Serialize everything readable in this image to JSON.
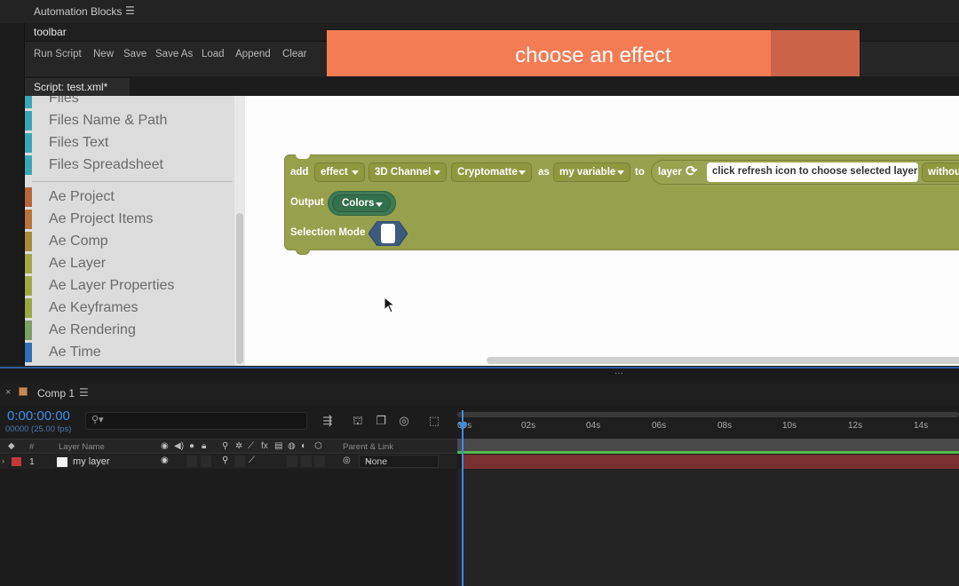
{
  "panel": {
    "title": "Automation Blocks",
    "menu_icon": "hamburger-icon"
  },
  "toolbar": {
    "label": "toolbar",
    "items": [
      "Run Script",
      "New",
      "Save",
      "Save As",
      "Load",
      "Append",
      "Clear"
    ]
  },
  "banner": {
    "text": "choose an effect",
    "color": "#f47c55"
  },
  "tab": {
    "label": "Script: test.xml*"
  },
  "categories": [
    {
      "label": "Files",
      "color": "#3ba7b5"
    },
    {
      "label": "Files Name & Path",
      "color": "#3ba7b5"
    },
    {
      "label": "Files Text",
      "color": "#3ba7b5"
    },
    {
      "label": "Files Spreadsheet",
      "color": "#3ba7b5"
    },
    {
      "label": "Ae Project",
      "color": "#b8663c"
    },
    {
      "label": "Ae Project Items",
      "color": "#b8733c"
    },
    {
      "label": "Ae Comp",
      "color": "#a88a3a"
    },
    {
      "label": "Ae Layer",
      "color": "#a3a744"
    },
    {
      "label": "Ae Layer Properties",
      "color": "#a0a844"
    },
    {
      "label": "Ae Keyframes",
      "color": "#9aa844"
    },
    {
      "label": "Ae Rendering",
      "color": "#78a063"
    },
    {
      "label": "Ae Time",
      "color": "#2f6fb5"
    }
  ],
  "block": {
    "add": "add",
    "effect": "effect",
    "channel": "3D Channel",
    "effect_name": "Cryptomatte",
    "as": "as",
    "variable": "my variable",
    "to": "to",
    "layer": "layer",
    "refresh_icon": "refresh-icon",
    "layer_field": "click refresh icon to choose selected layer",
    "without": "withou",
    "output": "Output",
    "colors": "Colors",
    "selection_mode": "Selection Mode",
    "block_color": "#97a04c"
  },
  "timeline": {
    "comp_name": "Comp 1",
    "timecode": "0:00:00:00",
    "fps": "00000 (25.00 fps)",
    "columns": {
      "num": "#",
      "layer_name": "Layer Name",
      "parent": "Parent & Link"
    },
    "ruler_ticks": [
      "00s",
      "02s",
      "04s",
      "06s",
      "08s",
      "10s",
      "12s",
      "14s"
    ],
    "layers": [
      {
        "num": "1",
        "name": "my layer",
        "parent": "None",
        "label_color": "#c0393b"
      }
    ]
  }
}
